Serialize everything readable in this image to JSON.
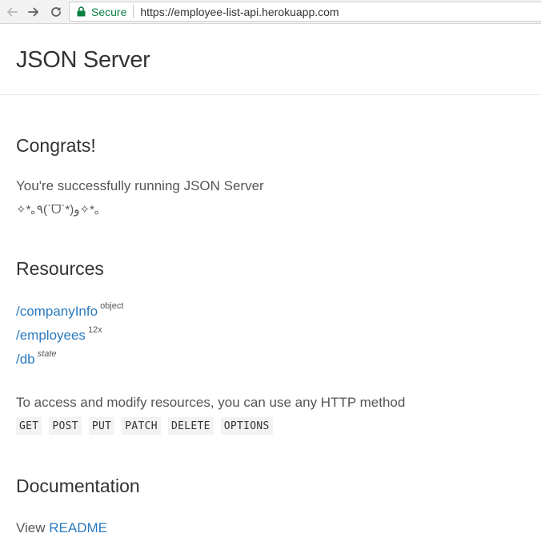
{
  "browser": {
    "secure_label": "Secure",
    "url": "https://employee-list-api.herokuapp.com",
    "colors": {
      "secure": "#0b8043",
      "link": "#2a7ac0"
    }
  },
  "page": {
    "title": "JSON Server"
  },
  "congrats": {
    "heading": "Congrats!",
    "message": "You're successfully running JSON Server",
    "kaomoji": "✧*｡٩(ˊᗜˋ*)و✧*｡"
  },
  "resources": {
    "heading": "Resources",
    "items": [
      {
        "label": "/companyInfo",
        "badge": "object"
      },
      {
        "label": "/employees",
        "badge": "12x"
      },
      {
        "label": "/db",
        "badge": "state"
      }
    ]
  },
  "access": {
    "text": "To access and modify resources, you can use any HTTP method",
    "methods": [
      "GET",
      "POST",
      "PUT",
      "PATCH",
      "DELETE",
      "OPTIONS"
    ]
  },
  "documentation": {
    "heading": "Documentation",
    "view_label": "View",
    "readme_label": "README"
  }
}
